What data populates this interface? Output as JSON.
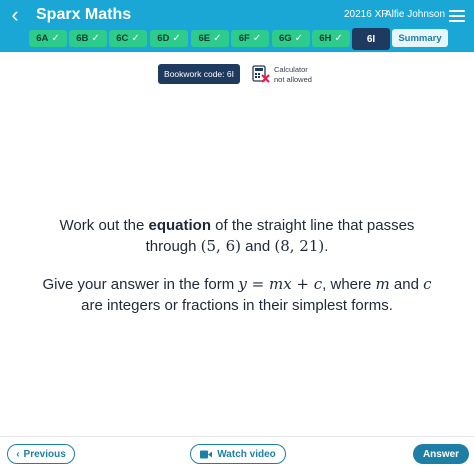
{
  "header": {
    "app_title": "Sparx Maths",
    "xp": "20216 XP",
    "user": "Alfie Johnson",
    "brand_color": "#1aa7d6"
  },
  "tabs": [
    {
      "label": "6A",
      "done": true
    },
    {
      "label": "6B",
      "done": true
    },
    {
      "label": "6C",
      "done": true
    },
    {
      "label": "6D",
      "done": true
    },
    {
      "label": "6E",
      "done": true
    },
    {
      "label": "6F",
      "done": true
    },
    {
      "label": "6G",
      "done": true
    },
    {
      "label": "6H",
      "done": true
    }
  ],
  "active_tab": {
    "label": "6I"
  },
  "summary_tab": {
    "label": "Summary"
  },
  "tick_symbol": "✓",
  "bookwork": {
    "label": "Bookwork code: 6I"
  },
  "calculator": {
    "line1": "Calculator",
    "line2": "not allowed"
  },
  "question": {
    "p1_pre": "Work out the ",
    "p1_bold": "equation",
    "p1_post": " of the straight line that passes",
    "p1_line2_pre": "through ",
    "point1": "(5, 6)",
    "and": " and ",
    "point2": "(8, 21)",
    "period": ".",
    "p2_pre": "Give your answer in the form ",
    "form_y": "y",
    "form_eq": " = ",
    "form_mx": "mx",
    "form_plus": " + ",
    "form_c": "c",
    "p2_mid": ", where ",
    "var_m": "m",
    "p2_and": " and ",
    "var_c": "c",
    "p2_line2": "are integers or fractions in their simplest forms."
  },
  "footer": {
    "previous": "Previous",
    "watch_video": "Watch video",
    "answer": "Answer"
  }
}
